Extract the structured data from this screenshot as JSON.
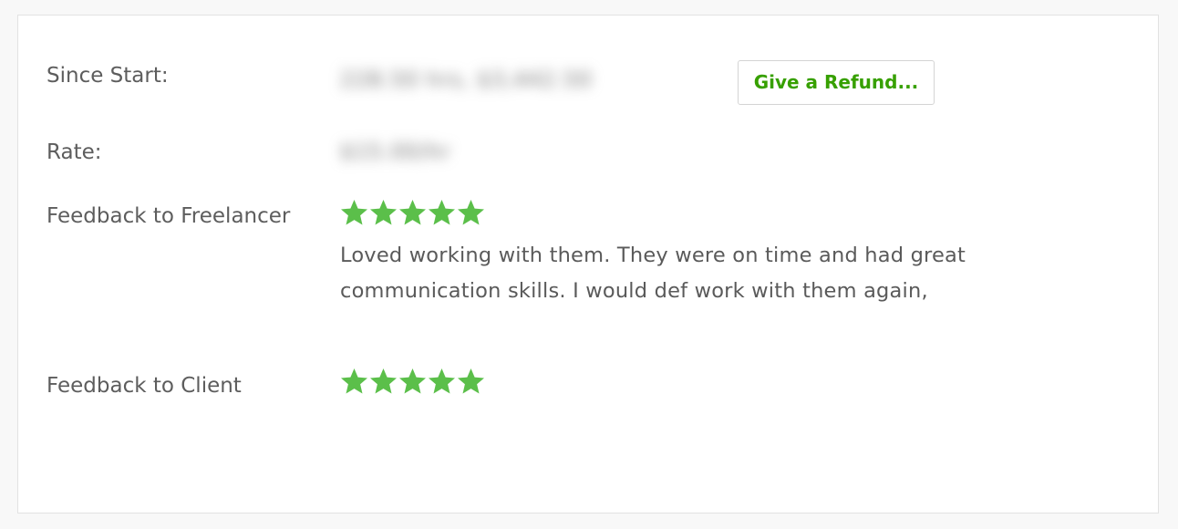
{
  "contract": {
    "since_start_label": "Since Start:",
    "since_start_value": "228.50 hrs, $3,442.50",
    "refund_button_label": "Give a Refund...",
    "rate_label": "Rate:",
    "rate_value": "$15.00/hr",
    "feedback_freelancer_label": "Feedback to Freelancer",
    "feedback_freelancer_rating": 5,
    "feedback_freelancer_rating_max": 5,
    "feedback_freelancer_text": "Loved working with them. They were on time and had great communication skills. I would def work with them again,",
    "feedback_client_label": "Feedback to Client",
    "feedback_client_rating": 5,
    "feedback_client_rating_max": 5
  },
  "colors": {
    "accent_green": "#37a000",
    "star_green": "#5bbf4a",
    "text": "#5a5a5a",
    "border": "#e2e2e2"
  },
  "icons": {
    "rating_star": "star-icon"
  }
}
